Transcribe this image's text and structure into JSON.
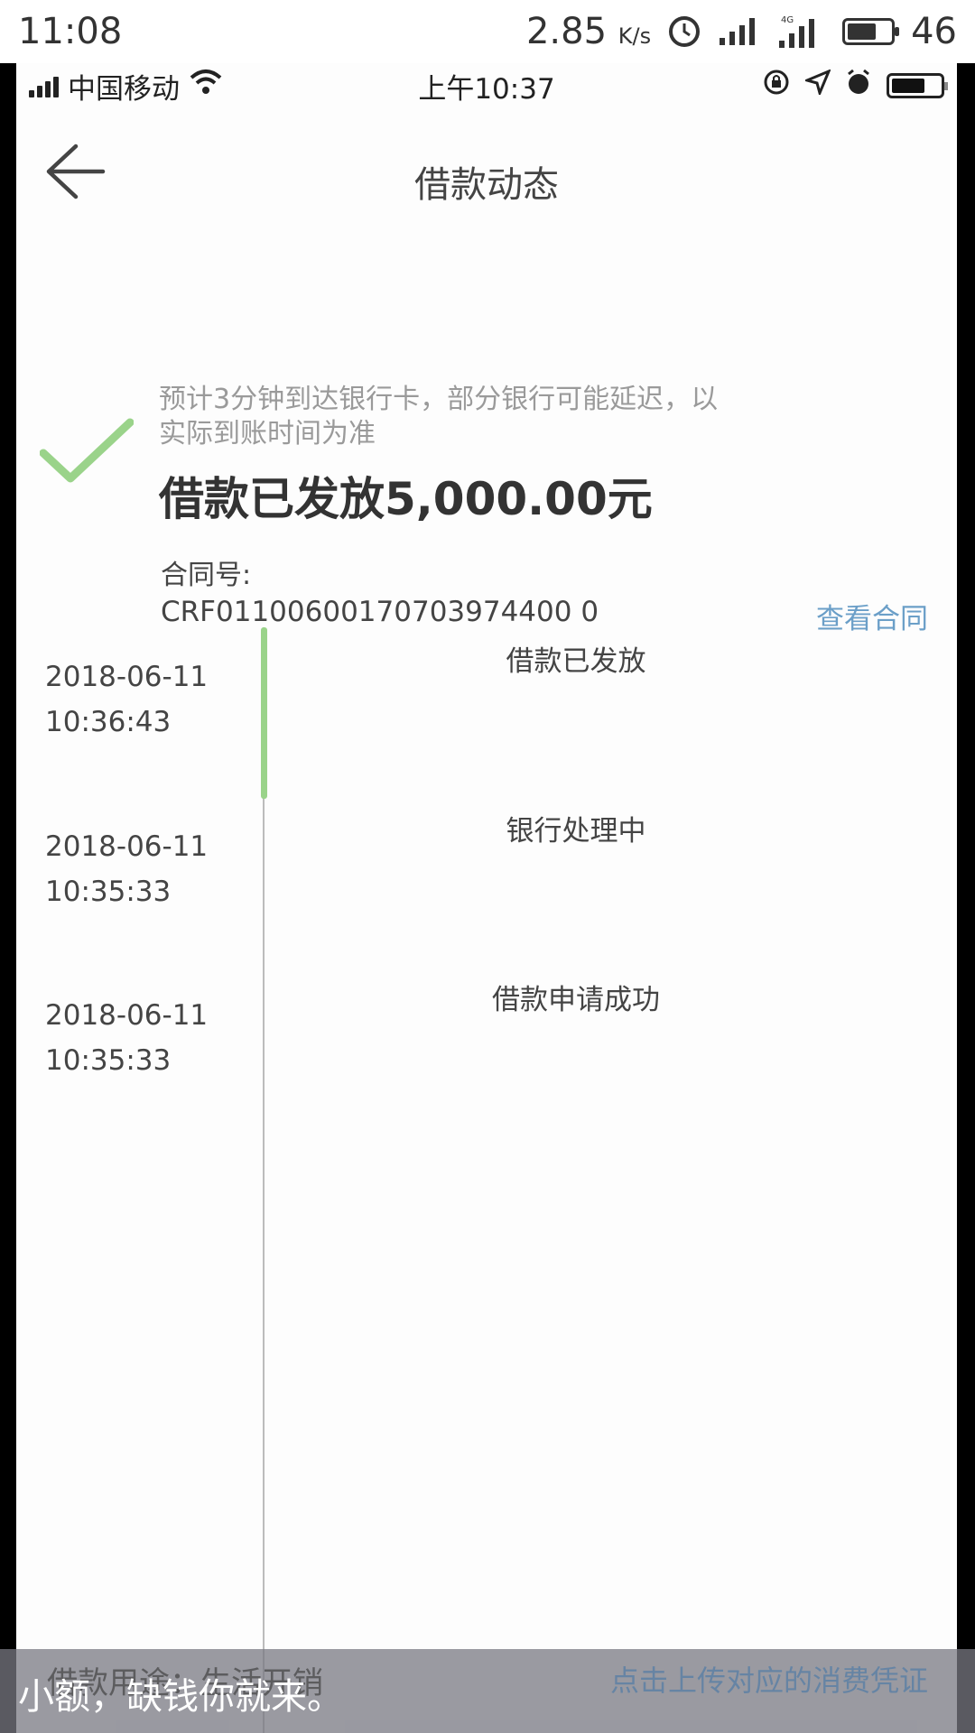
{
  "outer_status": {
    "time": "11:08",
    "speed": "2.85",
    "speed_unit": "K/s",
    "network_label": "4G",
    "battery_level": "46"
  },
  "inner_status": {
    "carrier": "中国移动",
    "clock": "上午10:37"
  },
  "nav": {
    "title": "借款动态"
  },
  "status": {
    "notice": "预计3分钟到达银行卡，部分银行可能延迟，以实际到账时间为准",
    "amount_text": "借款已发放5,000.00元",
    "contract_label": "合同号:",
    "contract_no": "CRF01100600170703974400 0",
    "view_contract": "查看合同"
  },
  "timeline": [
    {
      "label": "借款已发放",
      "date": "2018-06-11",
      "time": "10:36:43",
      "active": true
    },
    {
      "label": "银行处理中",
      "date": "2018-06-11",
      "time": "10:35:33",
      "active": false
    },
    {
      "label": "借款申请成功",
      "date": "2018-06-11",
      "time": "10:35:33",
      "active": false
    }
  ],
  "bottom": {
    "purpose": "借款用途：生活开销",
    "upload": "点击上传对应的消费凭证",
    "caption": "小额，缺钱你就来。"
  },
  "colors": {
    "accent_green": "#9ad38a",
    "link_blue": "#6b9fc8"
  }
}
